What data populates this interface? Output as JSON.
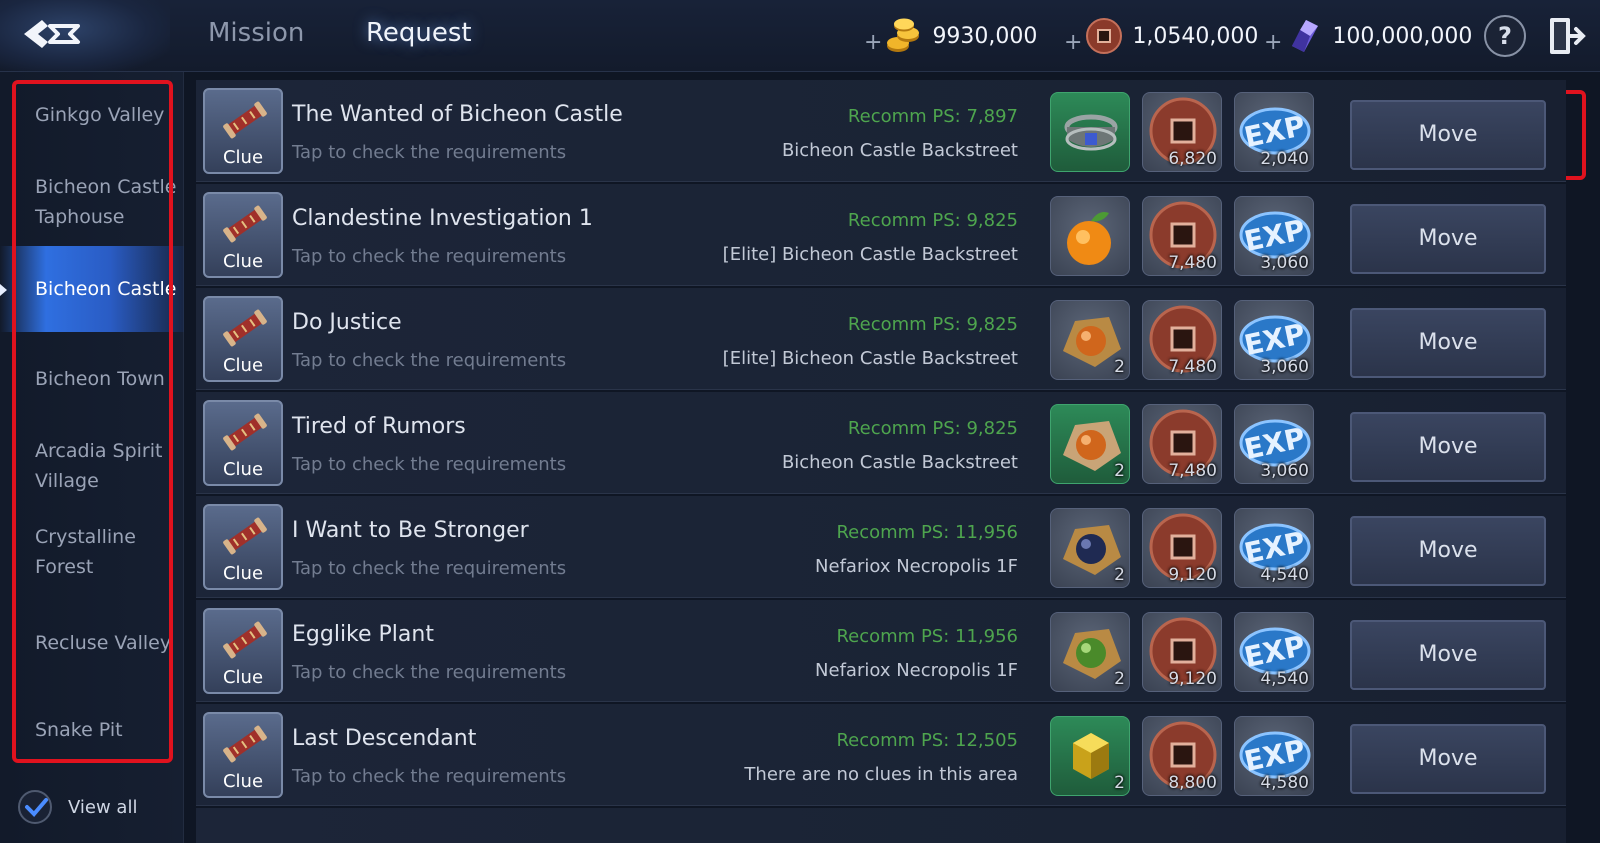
{
  "header": {
    "tabs": [
      {
        "label": "Mission",
        "active": false
      },
      {
        "label": "Request",
        "active": true
      }
    ],
    "currencies": [
      {
        "icon": "gold-coins-icon",
        "value": "9930,000",
        "plus": "+"
      },
      {
        "icon": "bronze-coin-icon",
        "value": "1,0540,000",
        "plus": "+"
      },
      {
        "icon": "crystal-icon",
        "value": "100,000,000",
        "plus": "+"
      }
    ],
    "help_label": "?"
  },
  "sidebar": {
    "items": [
      {
        "label": "Ginkgo Valley",
        "active": false
      },
      {
        "label": "Bicheon Castle Taphouse",
        "active": false
      },
      {
        "label": "Bicheon Castle",
        "active": true
      },
      {
        "label": "Bicheon Town",
        "active": false
      },
      {
        "label": "Arcadia Spirit Village",
        "active": false
      },
      {
        "label": "Crystalline Forest",
        "active": false
      },
      {
        "label": "Recluse Valley",
        "active": false
      },
      {
        "label": "Snake Pit",
        "active": false
      }
    ],
    "view_all_label": "View all",
    "view_all_checked": true
  },
  "requests": [
    {
      "clue": "Clue",
      "title": "The Wanted of Bicheon Castle",
      "subtitle": "Tap to check the requirements",
      "ps": "Recomm PS: 7,897",
      "location": "Bicheon Castle Backstreet",
      "item": {
        "icon": "bracelet-icon",
        "count": ""
      },
      "coin": "6,820",
      "exp": "2,040",
      "button": "Move"
    },
    {
      "clue": "Clue",
      "title": "Clandestine Investigation 1",
      "subtitle": "Tap to check the requirements",
      "ps": "Recomm PS: 9,825",
      "location": "[Elite] Bicheon Castle Backstreet",
      "item": {
        "icon": "orange-fruit-icon",
        "count": ""
      },
      "coin": "7,480",
      "exp": "3,060",
      "button": "Move"
    },
    {
      "clue": "Clue",
      "title": "Do Justice",
      "subtitle": "Tap to check the requirements",
      "ps": "Recomm PS: 9,825",
      "location": "[Elite] Bicheon Castle Backstreet",
      "item": {
        "icon": "orange-orb-icon",
        "count": "2"
      },
      "coin": "7,480",
      "exp": "3,060",
      "button": "Move"
    },
    {
      "clue": "Clue",
      "title": "Tired of Rumors",
      "subtitle": "Tap to check the requirements",
      "ps": "Recomm PS: 9,825",
      "location": "Bicheon Castle Backstreet",
      "item": {
        "icon": "orange-orb-icon",
        "count": "2"
      },
      "coin": "7,480",
      "exp": "3,060",
      "button": "Move"
    },
    {
      "clue": "Clue",
      "title": "I Want to Be Stronger",
      "subtitle": "Tap to check the requirements",
      "ps": "Recomm PS: 11,956",
      "location": "Nefariox Necropolis 1F",
      "item": {
        "icon": "blue-orb-icon",
        "count": "2"
      },
      "coin": "9,120",
      "exp": "4,540",
      "button": "Move"
    },
    {
      "clue": "Clue",
      "title": "Egglike Plant",
      "subtitle": "Tap to check the requirements",
      "ps": "Recomm PS: 11,956",
      "location": "Nefariox Necropolis 1F",
      "item": {
        "icon": "green-orb-icon",
        "count": "2"
      },
      "coin": "9,120",
      "exp": "4,540",
      "button": "Move"
    },
    {
      "clue": "Clue",
      "title": "Last Descendant",
      "subtitle": "Tap to check the requirements",
      "ps": "Recomm PS: 12,505",
      "location": "There are no clues in this area",
      "item": {
        "icon": "gold-cube-icon",
        "count": "2"
      },
      "coin": "8,800",
      "exp": "4,580",
      "button": "Move"
    }
  ],
  "colors": {
    "accent": "#2f6fe0",
    "highlight_box": "#e0121e",
    "recommend_ps": "#4ea54e"
  }
}
